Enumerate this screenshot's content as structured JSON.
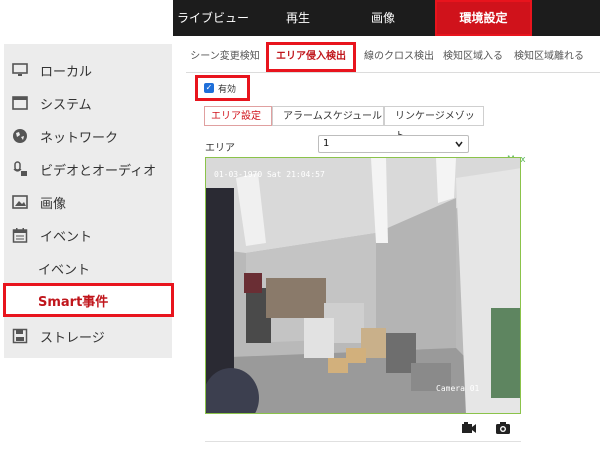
{
  "top_nav": {
    "items": [
      {
        "label": "ライブビュー"
      },
      {
        "label": "再生"
      },
      {
        "label": "画像"
      },
      {
        "label": "環境設定"
      }
    ]
  },
  "sidebar": {
    "items": [
      {
        "label": "ローカル",
        "icon": "monitor-icon"
      },
      {
        "label": "システム",
        "icon": "window-icon"
      },
      {
        "label": "ネットワーク",
        "icon": "globe-icon"
      },
      {
        "label": "ビデオとオーディオ",
        "icon": "microphone-icon"
      },
      {
        "label": "画像",
        "icon": "image-icon"
      },
      {
        "label": "イベント",
        "icon": "calendar-icon"
      },
      {
        "label": "イベント"
      },
      {
        "label": "Smart事件"
      },
      {
        "label": "ストレージ",
        "icon": "save-icon"
      }
    ]
  },
  "sub_tabs": [
    {
      "label": "シーン変更検知"
    },
    {
      "label": "エリア侵入検出"
    },
    {
      "label": "線のクロス検出"
    },
    {
      "label": "検知区域入る"
    },
    {
      "label": "検知区域離れる"
    }
  ],
  "enable": {
    "label": "有効",
    "checked": true
  },
  "steps": [
    {
      "label": "エリア設定"
    },
    {
      "label": "アラームスケジュール"
    },
    {
      "label": "リンケージメゾット"
    }
  ],
  "area": {
    "label": "エリア",
    "value": "1"
  },
  "video": {
    "osd_time": "01-03-1970 Sat 21:04:57",
    "osd_camera": "Camera 01",
    "max_label": "Max"
  },
  "colors": {
    "accent": "#d0121b",
    "highlight_border": "#e8141d",
    "nav_bg": "#1c1c1c",
    "sidebar_bg": "#ececec",
    "checkbox": "#1e6fd9",
    "video_border": "#8bc34a"
  }
}
